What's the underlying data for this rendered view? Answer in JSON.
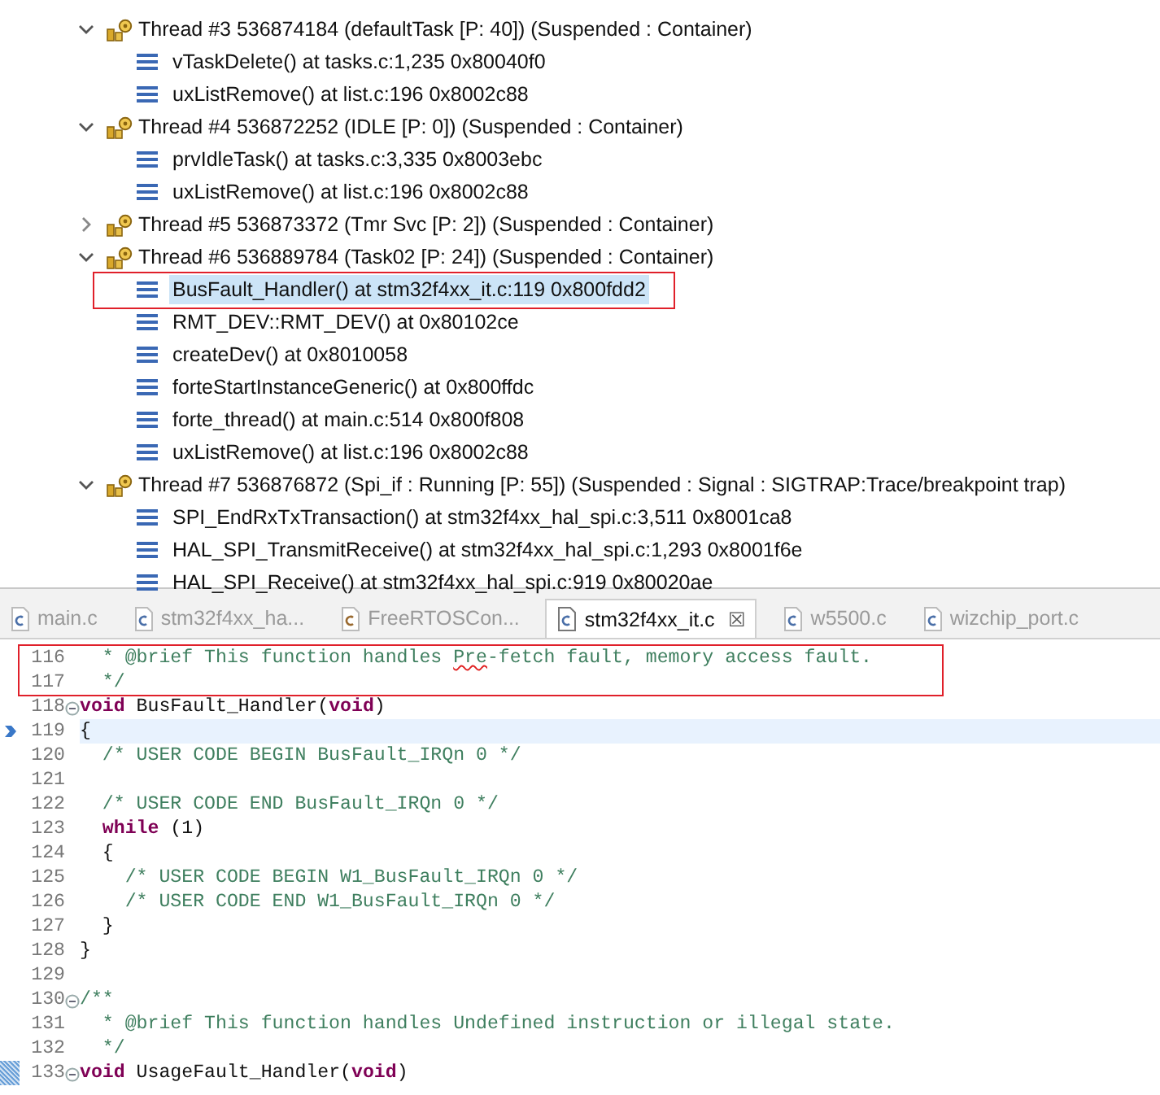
{
  "debug_tree": {
    "threads": [
      {
        "label": "Thread #3 536874184 (defaultTask [P: 40]) (Suspended : Container)",
        "expanded": true,
        "children": [
          {
            "label": "vTaskDelete() at tasks.c:1,235 0x80040f0",
            "selected": false,
            "annotated": false
          },
          {
            "label": "uxListRemove() at list.c:196 0x8002c88",
            "selected": false,
            "annotated": false
          }
        ]
      },
      {
        "label": "Thread #4 536872252 (IDLE [P: 0]) (Suspended : Container)",
        "expanded": true,
        "children": [
          {
            "label": "prvIdleTask() at tasks.c:3,335 0x8003ebc",
            "selected": false,
            "annotated": false
          },
          {
            "label": "uxListRemove() at list.c:196 0x8002c88",
            "selected": false,
            "annotated": false
          }
        ]
      },
      {
        "label": "Thread #5 536873372 (Tmr Svc [P: 2]) (Suspended : Container)",
        "expanded": false
      },
      {
        "label": "Thread #6 536889784 (Task02 [P: 24]) (Suspended : Container)",
        "expanded": true,
        "children": [
          {
            "label": "BusFault_Handler() at stm32f4xx_it.c:119 0x800fdd2",
            "selected": true,
            "annotated": true
          },
          {
            "label": "RMT_DEV::RMT_DEV() at 0x80102ce",
            "selected": false,
            "annotated": false
          },
          {
            "label": "createDev() at 0x8010058",
            "selected": false,
            "annotated": false
          },
          {
            "label": "forteStartInstanceGeneric() at 0x800ffdc",
            "selected": false,
            "annotated": false
          },
          {
            "label": "forte_thread() at main.c:514 0x800f808",
            "selected": false,
            "annotated": false
          },
          {
            "label": "uxListRemove() at list.c:196 0x8002c88",
            "selected": false,
            "annotated": false
          }
        ]
      },
      {
        "label": "Thread #7 536876872 (Spi_if : Running [P: 55]) (Suspended : Signal : SIGTRAP:Trace/breakpoint trap)",
        "expanded": true,
        "children": [
          {
            "label": "SPI_EndRxTxTransaction() at stm32f4xx_hal_spi.c:3,511 0x8001ca8",
            "selected": false,
            "annotated": false
          },
          {
            "label": "HAL_SPI_TransmitReceive() at stm32f4xx_hal_spi.c:1,293 0x8001f6e",
            "selected": false,
            "annotated": false
          },
          {
            "label": "HAL_SPI_Receive() at stm32f4xx_hal_spi.c:919 0x80020ae",
            "selected": false,
            "annotated": false
          }
        ]
      }
    ]
  },
  "editor_tabs": [
    {
      "label": "main.c",
      "kind": "c",
      "selected": false
    },
    {
      "label": "stm32f4xx_ha...",
      "kind": "c",
      "selected": false
    },
    {
      "label": "FreeRTOSCon...",
      "kind": "h",
      "selected": false
    },
    {
      "label": "stm32f4xx_it.c",
      "kind": "c",
      "selected": true,
      "close": "☒"
    },
    {
      "label": "w5500.c",
      "kind": "c",
      "selected": false
    },
    {
      "label": "wizchip_port.c",
      "kind": "c",
      "selected": false
    }
  ],
  "code_lines": [
    {
      "number": "116",
      "annotated": true,
      "current": false,
      "fold": false,
      "changed": false,
      "segments": [
        {
          "kind": "comment",
          "text": "  * @brief This function handles "
        },
        {
          "kind": "misspelled",
          "text": "Pre"
        },
        {
          "kind": "comment",
          "text": "-fetch fault, memory access fault."
        }
      ]
    },
    {
      "number": "117",
      "annotated": true,
      "current": false,
      "fold": false,
      "changed": false,
      "segments": [
        {
          "kind": "comment",
          "text": "  */"
        }
      ]
    },
    {
      "number": "118",
      "annotated": false,
      "current": false,
      "fold": true,
      "changed": false,
      "segments": [
        {
          "kind": "keyword",
          "text": "void"
        },
        {
          "kind": "plain",
          "text": " BusFault_Handler("
        },
        {
          "kind": "keyword",
          "text": "void"
        },
        {
          "kind": "plain",
          "text": ")"
        }
      ]
    },
    {
      "number": "119",
      "annotated": false,
      "current": true,
      "fold": false,
      "changed": false,
      "segments": [
        {
          "kind": "plain",
          "text": "{"
        }
      ]
    },
    {
      "number": "120",
      "annotated": false,
      "current": false,
      "fold": false,
      "changed": false,
      "segments": [
        {
          "kind": "comment",
          "text": "  /* USER CODE BEGIN BusFault_IRQn 0 */"
        }
      ]
    },
    {
      "number": "121",
      "annotated": false,
      "current": false,
      "fold": false,
      "changed": false
    },
    {
      "number": "122",
      "annotated": false,
      "current": false,
      "fold": false,
      "changed": false,
      "segments": [
        {
          "kind": "comment",
          "text": "  /* USER CODE END BusFault_IRQn 0 */"
        }
      ]
    },
    {
      "number": "123",
      "annotated": false,
      "current": false,
      "fold": false,
      "changed": false,
      "segments": [
        {
          "kind": "keyword",
          "text": "  while"
        },
        {
          "kind": "plain",
          "text": " (1)"
        }
      ]
    },
    {
      "number": "124",
      "annotated": false,
      "current": false,
      "fold": false,
      "changed": false,
      "segments": [
        {
          "kind": "plain",
          "text": "  {"
        }
      ]
    },
    {
      "number": "125",
      "annotated": false,
      "current": false,
      "fold": false,
      "changed": false,
      "segments": [
        {
          "kind": "comment",
          "text": "    /* USER CODE BEGIN W1_BusFault_IRQn 0 */"
        }
      ]
    },
    {
      "number": "126",
      "annotated": false,
      "current": false,
      "fold": false,
      "changed": false,
      "segments": [
        {
          "kind": "comment",
          "text": "    /* USER CODE END W1_BusFault_IRQn 0 */"
        }
      ]
    },
    {
      "number": "127",
      "annotated": false,
      "current": false,
      "fold": false,
      "changed": false,
      "segments": [
        {
          "kind": "plain",
          "text": "  }"
        }
      ]
    },
    {
      "number": "128",
      "annotated": false,
      "current": false,
      "fold": false,
      "changed": false,
      "segments": [
        {
          "kind": "plain",
          "text": "}"
        }
      ]
    },
    {
      "number": "129",
      "annotated": false,
      "current": false,
      "fold": false,
      "changed": false
    },
    {
      "number": "130",
      "annotated": false,
      "current": false,
      "fold": true,
      "changed": false,
      "segments": [
        {
          "kind": "comment",
          "text": "/**"
        }
      ]
    },
    {
      "number": "131",
      "annotated": false,
      "current": false,
      "fold": false,
      "changed": false,
      "segments": [
        {
          "kind": "comment",
          "text": "  * @brief This function handles Undefined instruction or illegal state."
        }
      ]
    },
    {
      "number": "132",
      "annotated": false,
      "current": false,
      "fold": false,
      "changed": false,
      "segments": [
        {
          "kind": "comment",
          "text": "  */"
        }
      ]
    },
    {
      "number": "133",
      "annotated": false,
      "current": false,
      "fold": true,
      "changed": true,
      "segments": [
        {
          "kind": "keyword",
          "text": "void"
        },
        {
          "kind": "plain",
          "text": " UsageFault_Handler("
        },
        {
          "kind": "keyword",
          "text": "void"
        },
        {
          "kind": "plain",
          "text": ")"
        }
      ]
    }
  ]
}
